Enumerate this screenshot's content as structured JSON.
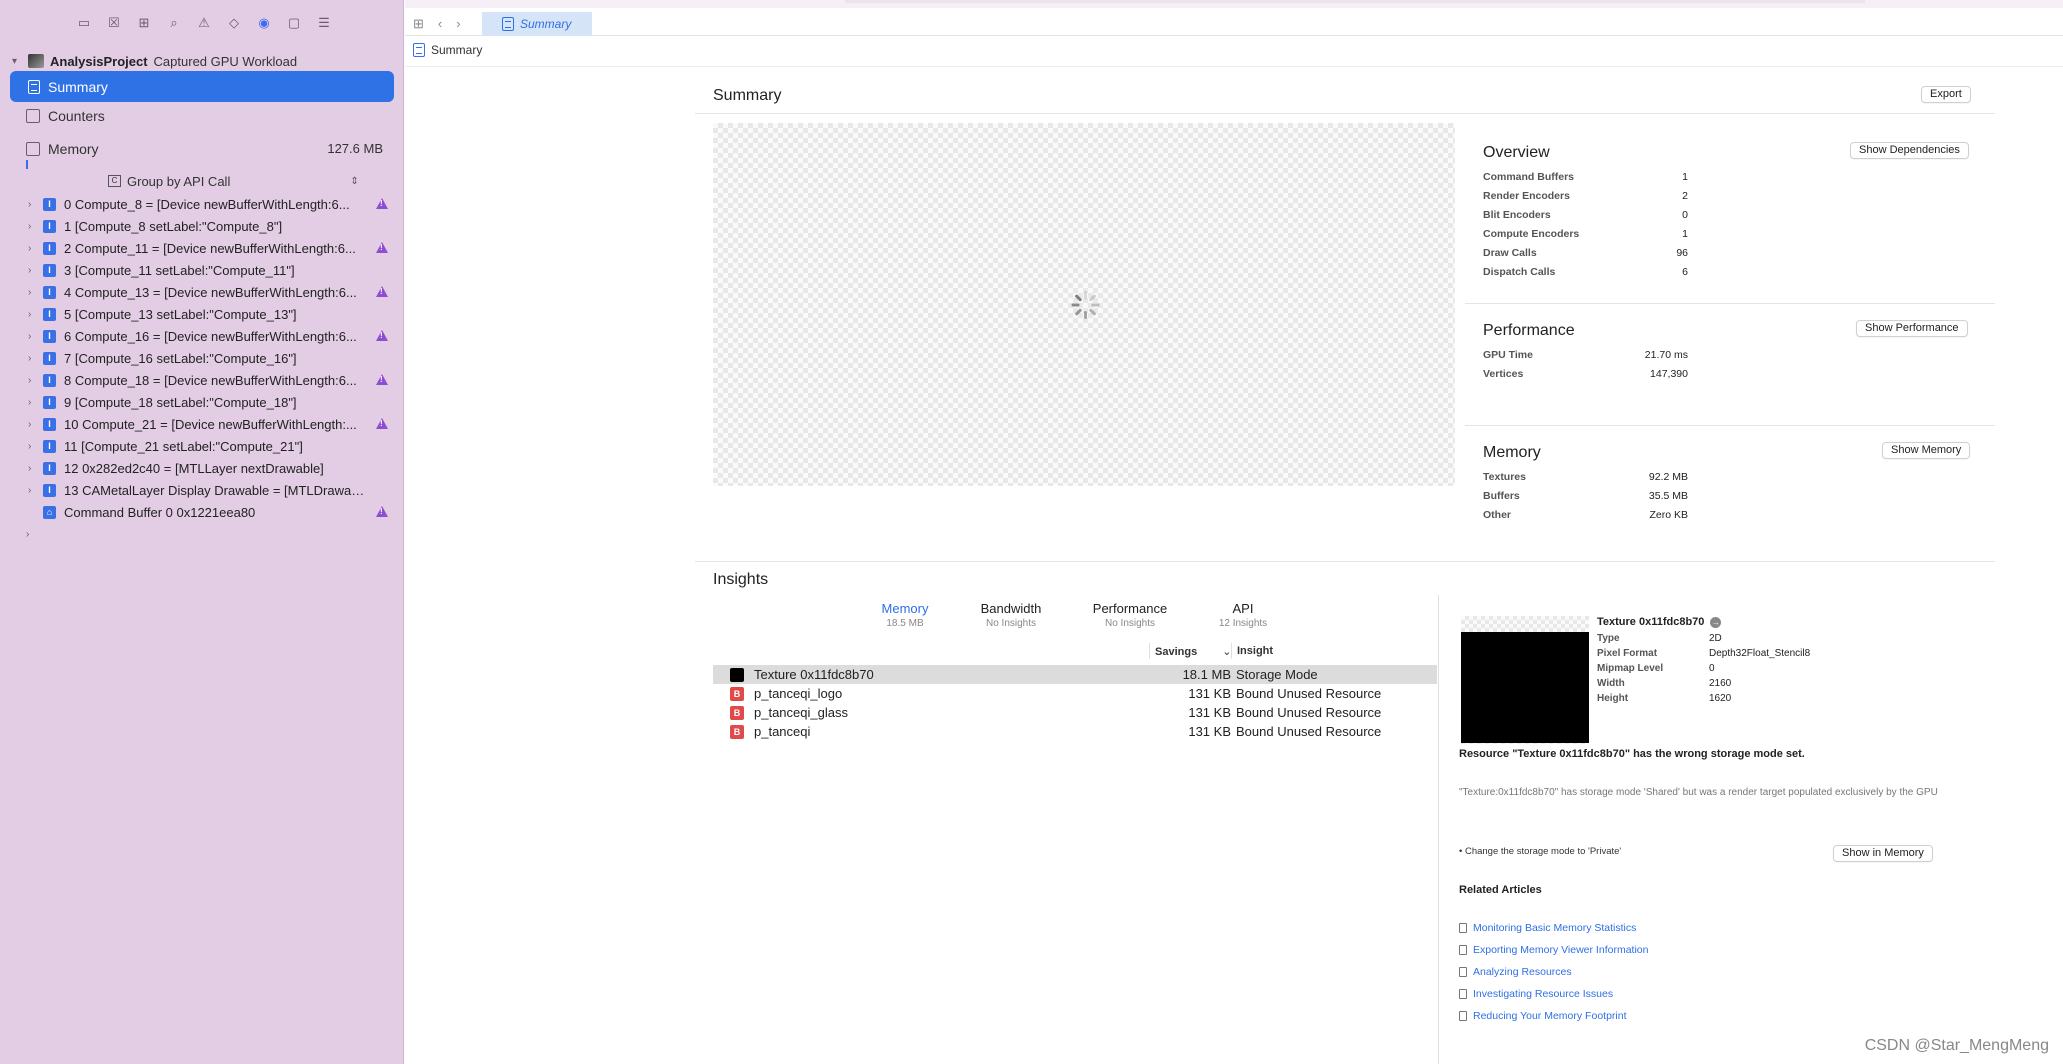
{
  "sidebar": {
    "project_name": "AnalysisProject",
    "project_sub": "Captured GPU Workload",
    "summary_label": "Summary",
    "counters_label": "Counters",
    "memory_label": "Memory",
    "memory_size": "127.6 MB",
    "group_by": "Group by API Call",
    "calls": [
      {
        "text": "0 Compute_8 = [Device newBufferWithLength:6...",
        "warn": true
      },
      {
        "text": "1 [Compute_8 setLabel:\"Compute_8\"]",
        "warn": false
      },
      {
        "text": "2 Compute_11 = [Device newBufferWithLength:6...",
        "warn": true
      },
      {
        "text": "3 [Compute_11 setLabel:\"Compute_11\"]",
        "warn": false
      },
      {
        "text": "4 Compute_13 = [Device newBufferWithLength:6...",
        "warn": true
      },
      {
        "text": "5 [Compute_13 setLabel:\"Compute_13\"]",
        "warn": false
      },
      {
        "text": "6 Compute_16 = [Device newBufferWithLength:6...",
        "warn": true
      },
      {
        "text": "7 [Compute_16 setLabel:\"Compute_16\"]",
        "warn": false
      },
      {
        "text": "8 Compute_18 = [Device newBufferWithLength:6...",
        "warn": true
      },
      {
        "text": "9 [Compute_18 setLabel:\"Compute_18\"]",
        "warn": false
      },
      {
        "text": "10 Compute_21 = [Device newBufferWithLength:...",
        "warn": true
      },
      {
        "text": "11 [Compute_21 setLabel:\"Compute_21\"]",
        "warn": false
      },
      {
        "text": "12 0x282ed2c40 = [MTLLayer nextDrawable]",
        "warn": false
      },
      {
        "text": "13 CAMetalLayer Display Drawable = [MTLDrawable...",
        "warn": false
      }
    ],
    "command_buffer": "Command Buffer 0 0x1221eea80"
  },
  "topbar": {
    "tab_label": "Summary"
  },
  "breadcrumb": {
    "label": "Summary"
  },
  "summary": {
    "title": "Summary",
    "export_label": "Export"
  },
  "overview": {
    "title": "Overview",
    "button": "Show Dependencies",
    "rows": [
      {
        "k": "Command Buffers",
        "v": "1"
      },
      {
        "k": "Render Encoders",
        "v": "2"
      },
      {
        "k": "Blit Encoders",
        "v": "0"
      },
      {
        "k": "Compute Encoders",
        "v": "1"
      },
      {
        "k": "Draw Calls",
        "v": "96"
      },
      {
        "k": "Dispatch Calls",
        "v": "6"
      }
    ]
  },
  "performance": {
    "title": "Performance",
    "button": "Show Performance",
    "rows": [
      {
        "k": "GPU Time",
        "v": "21.70 ms"
      },
      {
        "k": "Vertices",
        "v": "147,390"
      }
    ]
  },
  "memory": {
    "title": "Memory",
    "button": "Show Memory",
    "rows": [
      {
        "k": "Textures",
        "v": "92.2 MB"
      },
      {
        "k": "Buffers",
        "v": "35.5 MB"
      },
      {
        "k": "Other",
        "v": "Zero KB"
      }
    ]
  },
  "insights": {
    "title": "Insights",
    "tabs": [
      {
        "label": "Memory",
        "sub": "18.5 MB"
      },
      {
        "label": "Bandwidth",
        "sub": "No Insights"
      },
      {
        "label": "Performance",
        "sub": "No Insights"
      },
      {
        "label": "API",
        "sub": "12 Insights"
      }
    ],
    "col_savings": "Savings",
    "col_insight": "Insight",
    "rows": [
      {
        "name": "Texture 0x11fdc8b70",
        "savings": "18.1 MB",
        "insight": "Storage Mode"
      },
      {
        "name": "p_tanceqi_logo",
        "savings": "131 KB",
        "insight": "Bound Unused Resource"
      },
      {
        "name": "p_tanceqi_glass",
        "savings": "131 KB",
        "insight": "Bound Unused Resource"
      },
      {
        "name": "p_tanceqi",
        "savings": "131 KB",
        "insight": "Bound Unused Resource"
      }
    ]
  },
  "detail": {
    "title": "Texture 0x11fdc8b70",
    "props": [
      {
        "k": "Type",
        "v": "2D"
      },
      {
        "k": "Pixel Format",
        "v": "Depth32Float_Stencil8"
      },
      {
        "k": "Mipmap Level",
        "v": "0"
      },
      {
        "k": "Width",
        "v": "2160"
      },
      {
        "k": "Height",
        "v": "1620"
      }
    ],
    "warning": "Resource \"Texture 0x11fdc8b70\" has the wrong storage mode set.",
    "description": "\"Texture:0x11fdc8b70\" has storage mode 'Shared' but was a render target populated exclusively by the GPU",
    "fix": "• Change the storage mode to 'Private'",
    "show_in_memory": "Show in Memory",
    "related_title": "Related Articles",
    "articles": [
      "Monitoring Basic Memory Statistics",
      "Exporting Memory Viewer Information",
      "Analyzing Resources",
      "Investigating Resource Issues",
      "Reducing Your Memory Footprint"
    ]
  },
  "watermark": "CSDN @Star_MengMeng"
}
